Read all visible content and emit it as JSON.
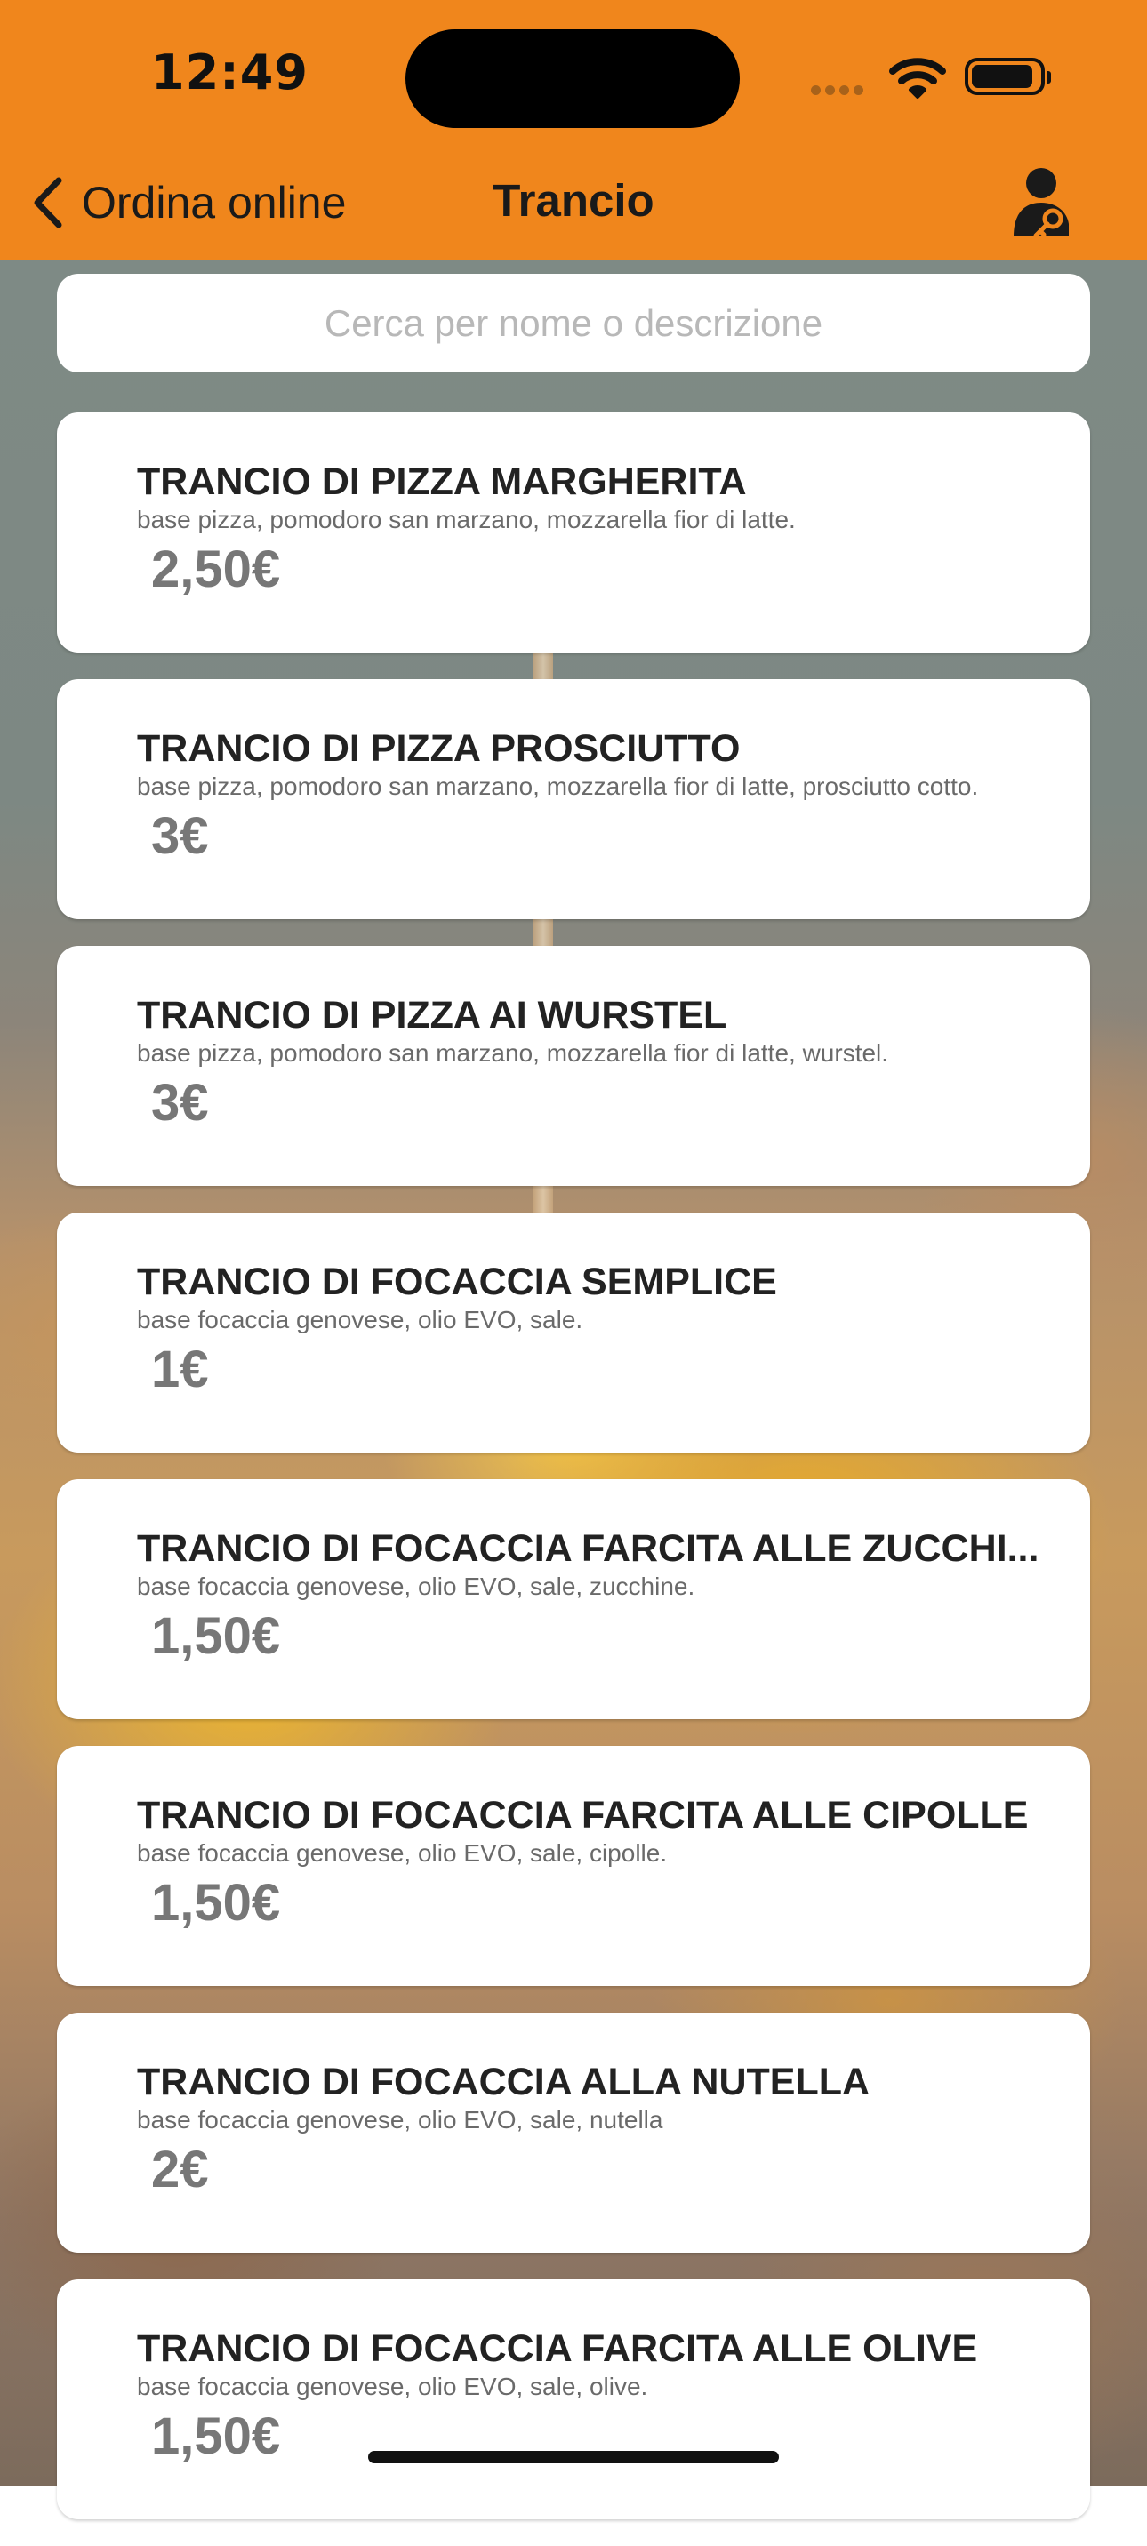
{
  "status_bar": {
    "time": "12:49"
  },
  "nav": {
    "back_label": "Ordina online",
    "title": "Trancio",
    "user_icon": "user-key-icon"
  },
  "search": {
    "placeholder": "Cerca per nome o descrizione",
    "value": ""
  },
  "colors": {
    "header": "#f0861c",
    "card": "#ffffff",
    "price": "#777777"
  },
  "products": [
    {
      "name": "TRANCIO DI PIZZA MARGHERITA",
      "description": "base pizza, pomodoro san marzano, mozzarella fior di latte.",
      "price": "2,50€"
    },
    {
      "name": "TRANCIO DI PIZZA PROSCIUTTO",
      "description": "base pizza, pomodoro san marzano, mozzarella fior di latte, prosciutto cotto.",
      "price": "3€"
    },
    {
      "name": "TRANCIO DI PIZZA AI WURSTEL",
      "description": "base pizza, pomodoro san marzano, mozzarella fior di latte, wurstel.",
      "price": "3€"
    },
    {
      "name": "TRANCIO DI FOCACCIA SEMPLICE",
      "description": "base focaccia genovese, olio EVO, sale.",
      "price": "1€"
    },
    {
      "name": "TRANCIO DI FOCACCIA FARCITA ALLE ZUCCHI...",
      "description": "base focaccia genovese, olio EVO, sale, zucchine.",
      "price": "1,50€"
    },
    {
      "name": "TRANCIO DI FOCACCIA FARCITA ALLE CIPOLLE",
      "description": "base focaccia genovese, olio EVO, sale, cipolle.",
      "price": "1,50€"
    },
    {
      "name": "TRANCIO DI FOCACCIA ALLA NUTELLA",
      "description": "base focaccia genovese, olio EVO, sale, nutella",
      "price": "2€"
    },
    {
      "name": "TRANCIO DI FOCACCIA FARCITA ALLE OLIVE",
      "description": "base focaccia genovese, olio EVO, sale, olive.",
      "price": "1,50€"
    }
  ]
}
